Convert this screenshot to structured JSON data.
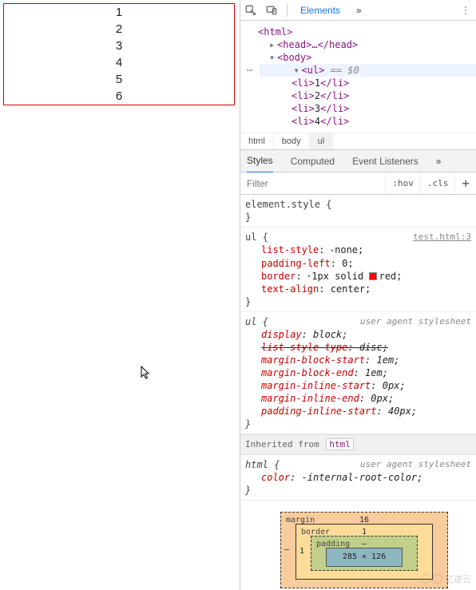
{
  "demo_list": [
    "1",
    "2",
    "3",
    "4",
    "5",
    "6"
  ],
  "devtools": {
    "toolbar": {
      "tab_elements": "Elements",
      "more": "»"
    },
    "dom": {
      "html_open": "<html>",
      "head": "<head>…</head>",
      "body_open": "<body>",
      "ul_open": "<ul>",
      "ul_hint": " == $0",
      "lis": [
        {
          "open": "<li>",
          "text": "1",
          "close": "</li>"
        },
        {
          "open": "<li>",
          "text": "2",
          "close": "</li>"
        },
        {
          "open": "<li>",
          "text": "3",
          "close": "</li>"
        },
        {
          "open": "<li>",
          "text": "4",
          "close": "</li>"
        }
      ]
    },
    "breadcrumbs": [
      "html",
      "body",
      "ul"
    ],
    "styles_tabs": {
      "styles": "Styles",
      "computed": "Computed",
      "listeners": "Event Listeners",
      "more": "»"
    },
    "filter": {
      "placeholder": "Filter",
      "hov": ":hov",
      "cls": ".cls",
      "plus": "+"
    },
    "rules": {
      "element_style": {
        "selector": "element.style",
        "open": " {",
        "close": "}"
      },
      "ul_author": {
        "selector": "ul",
        "open": " {",
        "close": "}",
        "source": "test.html:3",
        "decls": [
          {
            "prop": "list-style",
            "colon": ": ",
            "tri": true,
            "val": "none;"
          },
          {
            "prop": "padding-left",
            "colon": ": ",
            "val": "0;"
          },
          {
            "prop": "border",
            "colon": ": ",
            "tri": true,
            "val_pre": "1px solid ",
            "swatch": true,
            "val": "red;"
          },
          {
            "prop": "text-align",
            "colon": ": ",
            "val": "center;"
          }
        ]
      },
      "ul_ua": {
        "selector": "ul",
        "open": " {",
        "close": "}",
        "source": "user agent stylesheet",
        "decls": [
          {
            "prop": "display",
            "colon": ": ",
            "val": "block;",
            "strike": false
          },
          {
            "prop": "list-style-type",
            "colon": ": ",
            "val": "disc;",
            "strike": true
          },
          {
            "prop": "margin-block-start",
            "colon": ": ",
            "val": "1em;"
          },
          {
            "prop": "margin-block-end",
            "colon": ": ",
            "val": "1em;"
          },
          {
            "prop": "margin-inline-start",
            "colon": ": ",
            "val": "0px;"
          },
          {
            "prop": "margin-inline-end",
            "colon": ": ",
            "val": "0px;"
          },
          {
            "prop": "padding-inline-start",
            "colon": ": ",
            "val": "40px;"
          }
        ]
      },
      "inherited": {
        "label": "Inherited from ",
        "tag": "html"
      },
      "html_ua": {
        "selector": "html",
        "open": " {",
        "close": "}",
        "source": "user agent stylesheet",
        "decls": [
          {
            "prop": "color",
            "colon": ": ",
            "val": "-internal-root-color;"
          }
        ]
      }
    },
    "box_model": {
      "margin_label": "margin",
      "margin_top": "16",
      "border_label": "border",
      "border_top": "1",
      "padding_label": "padding",
      "padding_top": "–",
      "content": "285 × 126",
      "border_left": "1",
      "margin_left": "–"
    }
  },
  "watermark": "亿速云"
}
